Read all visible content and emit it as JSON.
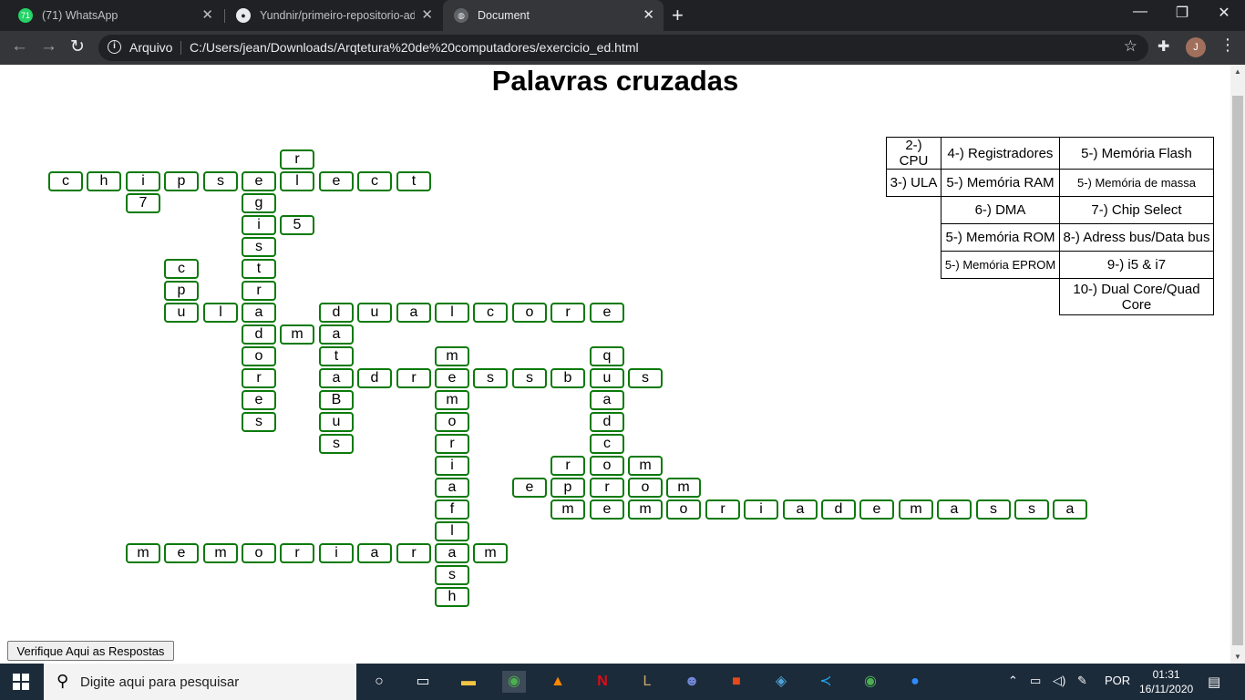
{
  "browser": {
    "tabs": [
      {
        "title": "(71) WhatsApp",
        "favicon": "whatsapp-icon",
        "badge": "71"
      },
      {
        "title": "Yundnir/primeiro-repositorio-ad",
        "favicon": "github-icon"
      },
      {
        "title": "Document",
        "favicon": "globe-icon",
        "active": true
      }
    ],
    "scheme_label": "Arquivo",
    "url": "C:/Users/jean/Downloads/Arqtetura%20de%20computadores/exercicio_ed.html",
    "profile_initial": "J"
  },
  "page": {
    "title": "Palavras cruzadas",
    "verify_button": "Verifique Aqui as Respostas",
    "crossword_cells": [
      {
        "r": 0,
        "c": 6,
        "l": "r"
      },
      {
        "r": 1,
        "c": 0,
        "l": "c"
      },
      {
        "r": 1,
        "c": 1,
        "l": "h"
      },
      {
        "r": 1,
        "c": 2,
        "l": "i"
      },
      {
        "r": 1,
        "c": 3,
        "l": "p"
      },
      {
        "r": 1,
        "c": 4,
        "l": "s"
      },
      {
        "r": 1,
        "c": 5,
        "l": "e"
      },
      {
        "r": 1,
        "c": 6,
        "l": "l"
      },
      {
        "r": 1,
        "c": 7,
        "l": "e"
      },
      {
        "r": 1,
        "c": 8,
        "l": "c"
      },
      {
        "r": 1,
        "c": 9,
        "l": "t"
      },
      {
        "r": 2,
        "c": 2,
        "l": "7"
      },
      {
        "r": 2,
        "c": 5,
        "l": "g"
      },
      {
        "r": 3,
        "c": 5,
        "l": "i"
      },
      {
        "r": 3,
        "c": 6,
        "l": "5"
      },
      {
        "r": 4,
        "c": 5,
        "l": "s"
      },
      {
        "r": 5,
        "c": 3,
        "l": "c"
      },
      {
        "r": 5,
        "c": 5,
        "l": "t"
      },
      {
        "r": 6,
        "c": 3,
        "l": "p"
      },
      {
        "r": 6,
        "c": 5,
        "l": "r"
      },
      {
        "r": 7,
        "c": 3,
        "l": "u"
      },
      {
        "r": 7,
        "c": 4,
        "l": "l"
      },
      {
        "r": 7,
        "c": 5,
        "l": "a"
      },
      {
        "r": 7,
        "c": 7,
        "l": "d"
      },
      {
        "r": 7,
        "c": 8,
        "l": "u"
      },
      {
        "r": 7,
        "c": 9,
        "l": "a"
      },
      {
        "r": 7,
        "c": 10,
        "l": "l"
      },
      {
        "r": 7,
        "c": 11,
        "l": "c"
      },
      {
        "r": 7,
        "c": 12,
        "l": "o"
      },
      {
        "r": 7,
        "c": 13,
        "l": "r"
      },
      {
        "r": 7,
        "c": 14,
        "l": "e"
      },
      {
        "r": 8,
        "c": 5,
        "l": "d"
      },
      {
        "r": 8,
        "c": 6,
        "l": "m"
      },
      {
        "r": 8,
        "c": 7,
        "l": "a"
      },
      {
        "r": 9,
        "c": 5,
        "l": "o"
      },
      {
        "r": 9,
        "c": 7,
        "l": "t"
      },
      {
        "r": 9,
        "c": 10,
        "l": "m"
      },
      {
        "r": 9,
        "c": 14,
        "l": "q"
      },
      {
        "r": 10,
        "c": 5,
        "l": "r"
      },
      {
        "r": 10,
        "c": 7,
        "l": "a"
      },
      {
        "r": 10,
        "c": 8,
        "l": "d"
      },
      {
        "r": 10,
        "c": 9,
        "l": "r"
      },
      {
        "r": 10,
        "c": 10,
        "l": "e"
      },
      {
        "r": 10,
        "c": 11,
        "l": "s"
      },
      {
        "r": 10,
        "c": 12,
        "l": "s"
      },
      {
        "r": 10,
        "c": 13,
        "l": "b"
      },
      {
        "r": 10,
        "c": 14,
        "l": "u"
      },
      {
        "r": 10,
        "c": 15,
        "l": "s"
      },
      {
        "r": 11,
        "c": 5,
        "l": "e"
      },
      {
        "r": 11,
        "c": 7,
        "l": "B"
      },
      {
        "r": 11,
        "c": 10,
        "l": "m"
      },
      {
        "r": 11,
        "c": 14,
        "l": "a"
      },
      {
        "r": 12,
        "c": 5,
        "l": "s"
      },
      {
        "r": 12,
        "c": 7,
        "l": "u"
      },
      {
        "r": 12,
        "c": 10,
        "l": "o"
      },
      {
        "r": 12,
        "c": 14,
        "l": "d"
      },
      {
        "r": 13,
        "c": 7,
        "l": "s"
      },
      {
        "r": 13,
        "c": 10,
        "l": "r"
      },
      {
        "r": 13,
        "c": 14,
        "l": "c"
      },
      {
        "r": 14,
        "c": 10,
        "l": "i"
      },
      {
        "r": 14,
        "c": 13,
        "l": "r"
      },
      {
        "r": 14,
        "c": 14,
        "l": "o"
      },
      {
        "r": 14,
        "c": 15,
        "l": "m"
      },
      {
        "r": 15,
        "c": 10,
        "l": "a"
      },
      {
        "r": 15,
        "c": 12,
        "l": "e"
      },
      {
        "r": 15,
        "c": 13,
        "l": "p"
      },
      {
        "r": 15,
        "c": 14,
        "l": "r"
      },
      {
        "r": 15,
        "c": 15,
        "l": "o"
      },
      {
        "r": 15,
        "c": 16,
        "l": "m"
      },
      {
        "r": 16,
        "c": 10,
        "l": "f"
      },
      {
        "r": 16,
        "c": 13,
        "l": "m"
      },
      {
        "r": 16,
        "c": 14,
        "l": "e"
      },
      {
        "r": 16,
        "c": 15,
        "l": "m"
      },
      {
        "r": 16,
        "c": 16,
        "l": "o"
      },
      {
        "r": 16,
        "c": 17,
        "l": "r"
      },
      {
        "r": 16,
        "c": 18,
        "l": "i"
      },
      {
        "r": 16,
        "c": 19,
        "l": "a"
      },
      {
        "r": 16,
        "c": 20,
        "l": "d"
      },
      {
        "r": 16,
        "c": 21,
        "l": "e"
      },
      {
        "r": 16,
        "c": 22,
        "l": "m"
      },
      {
        "r": 16,
        "c": 23,
        "l": "a"
      },
      {
        "r": 16,
        "c": 24,
        "l": "s"
      },
      {
        "r": 16,
        "c": 25,
        "l": "s"
      },
      {
        "r": 16,
        "c": 26,
        "l": "a"
      },
      {
        "r": 17,
        "c": 10,
        "l": "l"
      },
      {
        "r": 18,
        "c": 2,
        "l": "m"
      },
      {
        "r": 18,
        "c": 3,
        "l": "e"
      },
      {
        "r": 18,
        "c": 4,
        "l": "m"
      },
      {
        "r": 18,
        "c": 5,
        "l": "o"
      },
      {
        "r": 18,
        "c": 6,
        "l": "r"
      },
      {
        "r": 18,
        "c": 7,
        "l": "i"
      },
      {
        "r": 18,
        "c": 8,
        "l": "a"
      },
      {
        "r": 18,
        "c": 9,
        "l": "r"
      },
      {
        "r": 18,
        "c": 10,
        "l": "a"
      },
      {
        "r": 18,
        "c": 11,
        "l": "m"
      },
      {
        "r": 19,
        "c": 10,
        "l": "s"
      },
      {
        "r": 20,
        "c": 10,
        "l": "h"
      }
    ],
    "clues": [
      [
        "2-) CPU",
        "4-) Registradores",
        "5-) Memória Flash"
      ],
      [
        "3-) ULA",
        "5-) Memória RAM",
        "5-) Memória de massa"
      ],
      [
        "",
        "6-) DMA",
        "7-) Chip Select"
      ],
      [
        "",
        "5-) Memória ROM",
        "8-) Adress bus/Data bus"
      ],
      [
        "",
        "5-) Memória EPROM",
        "9-) i5 & i7"
      ],
      [
        "",
        "",
        "10-) Dual Core/Quad Core"
      ]
    ]
  },
  "taskbar": {
    "search_placeholder": "Digite aqui para pesquisar",
    "language": "POR",
    "time": "01:31",
    "date": "16/11/2020",
    "notifications": "1"
  }
}
